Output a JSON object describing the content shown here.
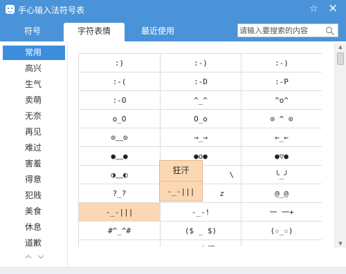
{
  "window": {
    "title": "手心输入法符号表",
    "accent_color": "#4b93d8",
    "icons": {
      "app": "app-smiley-icon",
      "pin": "pin-star-icon",
      "close": "close-icon",
      "search": "search-icon"
    }
  },
  "tabs": [
    {
      "label": "符号",
      "active": false
    },
    {
      "label": "字符表情",
      "active": true
    },
    {
      "label": "最近使用",
      "active": false
    }
  ],
  "search": {
    "placeholder": "请输入要搜索的内容"
  },
  "sidebar": {
    "items": [
      {
        "label": "常用",
        "active": true
      },
      {
        "label": "高兴",
        "active": false
      },
      {
        "label": "生气",
        "active": false
      },
      {
        "label": "卖萌",
        "active": false
      },
      {
        "label": "无奈",
        "active": false
      },
      {
        "label": "再见",
        "active": false
      },
      {
        "label": "难过",
        "active": false
      },
      {
        "label": "害羞",
        "active": false
      },
      {
        "label": "得意",
        "active": false
      },
      {
        "label": "犯贱",
        "active": false
      },
      {
        "label": "美食",
        "active": false
      },
      {
        "label": "休息",
        "active": false
      },
      {
        "label": "道歉",
        "active": false
      }
    ]
  },
  "grid": {
    "rows": [
      [
        ":)",
        ":-)",
        ":-)"
      ],
      [
        ":-(",
        ":-D",
        ":-P"
      ],
      [
        ":-O",
        "^_^",
        "^o^"
      ],
      [
        "o_O",
        "O_o",
        "⊙ ^ ⊙"
      ],
      [
        "⊙﹏⊙",
        "→_→",
        "←_←"
      ],
      [
        "●﹏●",
        "●o●",
        "●▽●"
      ],
      [
        "◑﹏◐",
        "",
        "╰_╯"
      ],
      [
        "?_?",
        "",
        "@_@"
      ],
      [
        "-_-|||",
        "-_-!",
        "一 一+"
      ],
      [
        "#^_^#",
        "($ _ $)",
        "(☆_☆)"
      ],
      [
        "(⊙o⊙)?",
        "⊙_⊙卜汗",
        "\\(^o^)/"
      ]
    ],
    "partial": {
      "r6c1": "\\",
      "r7c1": "z"
    },
    "highlight": {
      "row": 8,
      "col": 0,
      "color": "#fbd7b4"
    }
  },
  "popup": {
    "items": [
      "狂汗",
      "-_-|||"
    ]
  }
}
